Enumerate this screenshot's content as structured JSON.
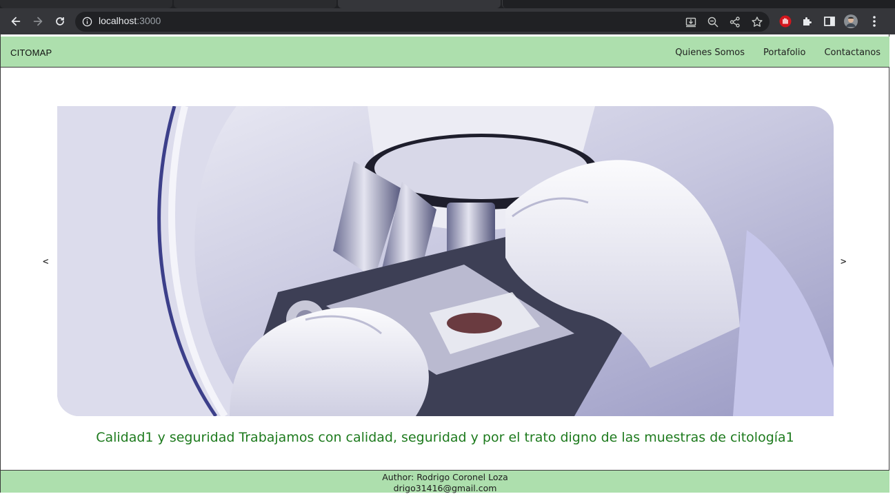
{
  "browser": {
    "url_host": "localhost",
    "url_port": ":3000",
    "icons": [
      "back-icon",
      "forward-icon",
      "reload-icon",
      "site-info-icon",
      "install-icon",
      "zoom-icon",
      "share-icon",
      "bookmark-star-icon",
      "extension-red-icon",
      "puzzle-icon",
      "side-panel-icon",
      "profile-avatar",
      "menu-kebab-icon"
    ]
  },
  "navbar": {
    "brand": "CITOMAP",
    "links": [
      "Quienes Somos",
      "Portafolio",
      "Contactanos"
    ],
    "background": "#addfad"
  },
  "carousel": {
    "prev": "<",
    "next": ">",
    "image": "microscope-lab-photo"
  },
  "caption": "Calidad1 y seguridad Trabajamos con calidad, seguridad y por el trato digno de las muestras de citología1",
  "footer": {
    "author": "Author: Rodrigo Coronel Loza",
    "email": "drigo31416@gmail.com"
  },
  "colors": {
    "accent_green": "#addfad",
    "caption_green": "#1d7a1d"
  }
}
